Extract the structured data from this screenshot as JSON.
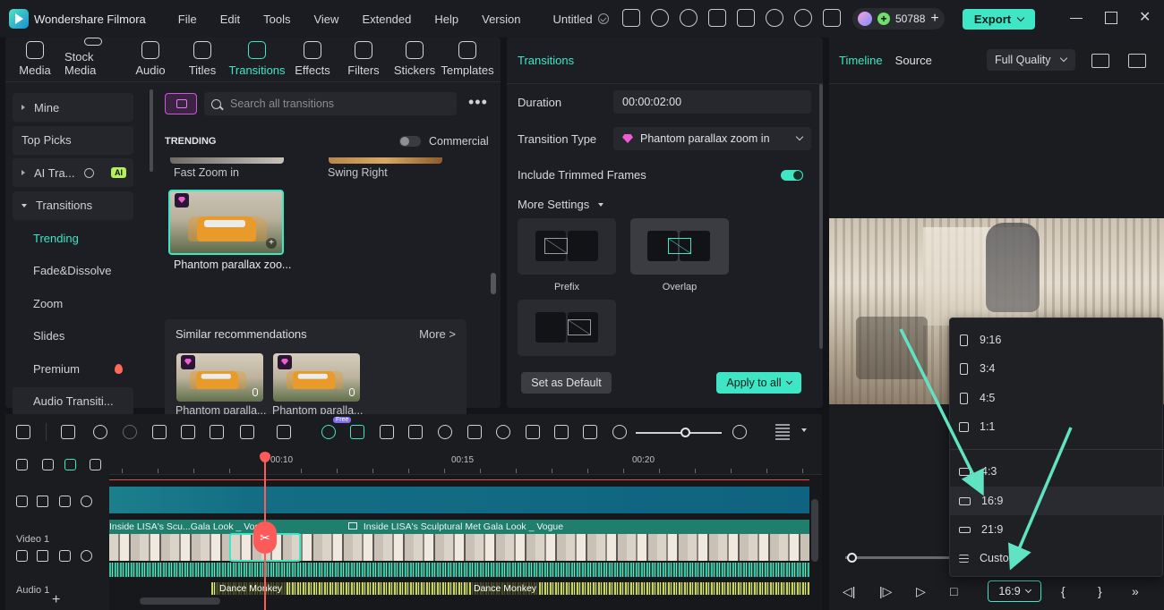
{
  "titlebar": {
    "app_name": "Wondershare Filmora",
    "menu": [
      "File",
      "Edit",
      "Tools",
      "View",
      "Extended",
      "Help",
      "Version"
    ],
    "project_name": "Untitled",
    "credits": "50788",
    "export_label": "Export"
  },
  "media_tabs": [
    {
      "label": "Media",
      "icon": "media-icon"
    },
    {
      "label": "Stock Media",
      "icon": "stock-media-icon"
    },
    {
      "label": "Audio",
      "icon": "music-note-icon"
    },
    {
      "label": "Titles",
      "icon": "text-t-icon"
    },
    {
      "label": "Transitions",
      "icon": "transitions-icon",
      "active": true
    },
    {
      "label": "Effects",
      "icon": "effects-sparkle-icon"
    },
    {
      "label": "Filters",
      "icon": "filters-icon"
    },
    {
      "label": "Stickers",
      "icon": "sticker-icon"
    },
    {
      "label": "Templates",
      "icon": "templates-icon"
    }
  ],
  "sidebar": {
    "items": [
      {
        "label": "Mine"
      },
      {
        "label": "Top Picks"
      },
      {
        "label": "AI Tra...",
        "badge": "AI"
      },
      {
        "label": "Transitions"
      },
      {
        "label": "Trending"
      },
      {
        "label": "Fade&Dissolve"
      },
      {
        "label": "Zoom"
      },
      {
        "label": "Slides"
      },
      {
        "label": "Premium"
      },
      {
        "label": "Audio Transiti..."
      }
    ]
  },
  "browser": {
    "search_placeholder": "Search all transitions",
    "section_title": "TRENDING",
    "commercial_label": "Commercial",
    "partial_items": [
      "Fast Zoom in",
      "Swing Right"
    ],
    "selected_item": "Phantom parallax zoo...",
    "similar_title": "Similar recommendations",
    "similar_more": "More >",
    "similar_items": [
      "Phantom paralla...",
      "Phantom paralla..."
    ]
  },
  "properties": {
    "header": "Transitions",
    "duration_label": "Duration",
    "duration_value": "00:00:02:00",
    "type_label": "Transition Type",
    "type_value": "Phantom parallax zoom in",
    "trimmed_label": "Include Trimmed Frames",
    "trimmed_on": true,
    "more_settings": "More Settings",
    "modes": [
      "Prefix",
      "Overlap"
    ],
    "default_label": "Set as Default",
    "apply_label": "Apply to all"
  },
  "player": {
    "tab_timeline": "Timeline",
    "tab_source": "Source",
    "quality": "Full Quality",
    "ratio_value": "16:9",
    "ratio_options": [
      "9:16",
      "3:4",
      "4:5",
      "1:1",
      "4:3",
      "16:9",
      "21:9",
      "Custom"
    ],
    "highlighted_option": "16:9"
  },
  "timeline": {
    "ruler": [
      "00:10",
      "00:15",
      "00:20"
    ],
    "video_track": "Video 1",
    "audio_track": "Audio 1",
    "clip_title_1": "Inside LISA's Scu...Gala Look _ Vogue",
    "clip_title_2": "Inside LISA's Sculptural Met Gala Look _ Vogue",
    "audio_clip_1": "Dance Monkey",
    "audio_clip_2": "Dance Monkey",
    "free_badge": "Free"
  },
  "colors": {
    "accent": "#3ee6c5",
    "playhead": "#ff5a5a",
    "premium": "#f05bd2",
    "background": "#131418"
  }
}
